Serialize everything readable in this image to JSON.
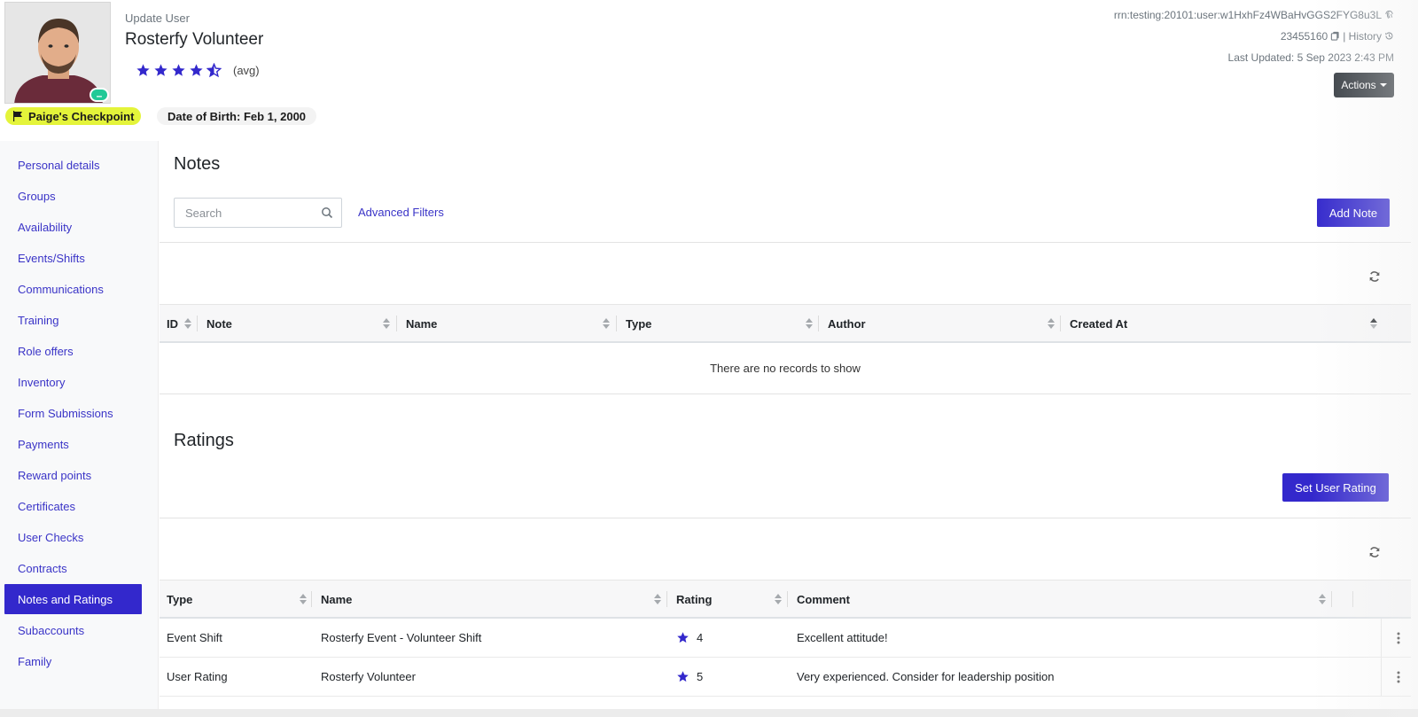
{
  "header": {
    "eyebrow": "Update User",
    "user_name": "Rosterfy Volunteer",
    "rating_label": "(avg)",
    "rating_value": 4.5,
    "rating_max": 5,
    "status_glyph": "–",
    "checkpoint_label": "Paige's Checkpoint",
    "dob_label": "Date of Birth: Feb 1, 2000",
    "rrn": "rrn:testing:20101:user:w1HxhFz4WBaHvGGS2FYG8u3L",
    "user_id": "23455160",
    "history_label": "| History",
    "last_updated": "Last Updated: 5 Sep 2023 2:43 PM",
    "actions_label": "Actions",
    "icons": {
      "star": "star-icon",
      "flag": "flag-icon",
      "fingerprint": "fingerprint-icon",
      "copy": "copy-icon",
      "history": "history-icon"
    }
  },
  "sidebar": {
    "items": [
      {
        "label": "Personal details"
      },
      {
        "label": "Groups"
      },
      {
        "label": "Availability"
      },
      {
        "label": "Events/Shifts"
      },
      {
        "label": "Communications"
      },
      {
        "label": "Training"
      },
      {
        "label": "Role offers"
      },
      {
        "label": "Inventory"
      },
      {
        "label": "Form Submissions"
      },
      {
        "label": "Payments"
      },
      {
        "label": "Reward points"
      },
      {
        "label": "Certificates"
      },
      {
        "label": "User Checks"
      },
      {
        "label": "Contracts"
      },
      {
        "label": "Notes and Ratings",
        "active": true
      },
      {
        "label": "Subaccounts"
      },
      {
        "label": "Family"
      }
    ]
  },
  "notes": {
    "title": "Notes",
    "search_placeholder": "Search",
    "advanced_filters": "Advanced Filters",
    "add_label": "Add Note",
    "columns": [
      "ID",
      "Note",
      "Name",
      "Type",
      "Author",
      "Created At"
    ],
    "empty_text": "There are no records to show"
  },
  "ratings": {
    "title": "Ratings",
    "set_label": "Set User Rating",
    "columns": [
      "Type",
      "Name",
      "Rating",
      "Comment"
    ],
    "rows": [
      {
        "type": "Event Shift",
        "name": "Rosterfy Event - Volunteer Shift",
        "rating": "4",
        "comment": "Excellent attitude!"
      },
      {
        "type": "User Rating",
        "name": "Rosterfy Volunteer",
        "rating": "5",
        "comment": "Very experienced. Consider for leadership position"
      }
    ]
  },
  "colors": {
    "primary": "#3328cc",
    "link": "#3a34c7",
    "checkpoint": "#e4f43a",
    "status": "#20c997",
    "dark_button": "#343a40"
  }
}
